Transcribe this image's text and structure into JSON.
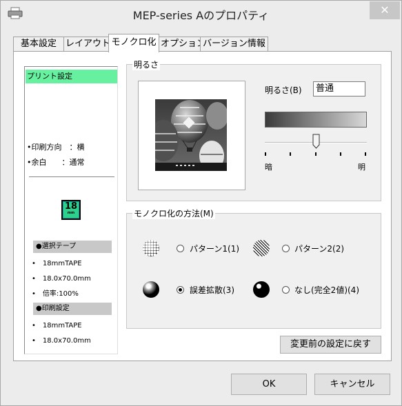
{
  "window": {
    "title": "MEP-series Aのプロパティ",
    "close_symbol": "✕"
  },
  "tabs": [
    {
      "label": "基本設定"
    },
    {
      "label": "レイアウト"
    },
    {
      "label": "モノクロ化"
    },
    {
      "label": "オプション"
    },
    {
      "label": "バージョン情報"
    }
  ],
  "active_tab": "モノクロ化",
  "preview": {
    "header": "プリント設定",
    "lines": [
      "•印刷方向　：横",
      "•余白　　：通常"
    ],
    "tape_icon": {
      "number": "18",
      "unit": "mm"
    },
    "selected_tape": {
      "title": "●選択テープ",
      "items": [
        "•　18mmTAPE",
        "•　18.0x70.0mm",
        "•　倍率:100%"
      ]
    },
    "print_settings": {
      "title": "●印刷設定",
      "items": [
        "•　18mmTAPE",
        "•　18.0x70.0mm"
      ]
    }
  },
  "brightness": {
    "group_label": "明るさ",
    "field_label": "明るさ(B)",
    "value": "普通",
    "slider_min_label": "暗",
    "slider_max_label": "明",
    "slider_level": 0.5,
    "ticks": 5
  },
  "monochrome": {
    "group_label": "モノクロ化の方法(M)",
    "options": [
      {
        "label": "パターン1(1)",
        "checked": false,
        "icon": "pattern1-ball-icon"
      },
      {
        "label": "パターン2(2)",
        "checked": false,
        "icon": "pattern2-ball-icon"
      },
      {
        "label": "誤差拡散(3)",
        "checked": true,
        "icon": "error-diffusion-ball-icon"
      },
      {
        "label": "なし(完全2値)(4)",
        "checked": false,
        "icon": "binary-ball-icon"
      }
    ]
  },
  "buttons": {
    "restore": "変更前の設定に戻す",
    "ok": "OK",
    "cancel": "キャンセル"
  }
}
